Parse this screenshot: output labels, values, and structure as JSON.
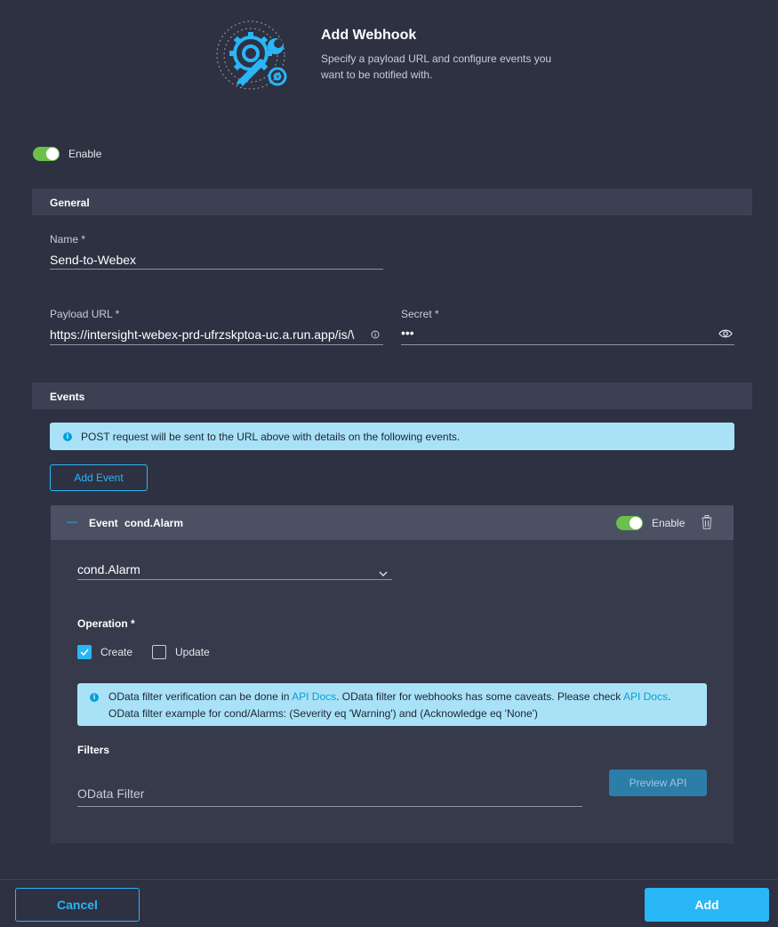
{
  "header": {
    "title": "Add Webhook",
    "subtitle": "Specify a payload URL and configure events you want to be notified with."
  },
  "enable": {
    "label": "Enable",
    "on": true
  },
  "general": {
    "section_title": "General",
    "name_label": "Name *",
    "name_value": "Send-to-Webex",
    "payload_label": "Payload URL *",
    "payload_value": "https://intersight-webex-prd-ufrzskptoa-uc.a.run.app/is/\\",
    "secret_label": "Secret *",
    "secret_value": "•••"
  },
  "events": {
    "section_title": "Events",
    "info_text": "POST request will be sent to the URL above with details on the following events.",
    "add_event_label": "Add Event",
    "event": {
      "collapse_symbol": "—",
      "label": "Event",
      "name": "cond.Alarm",
      "enable_label": "Enable",
      "enabled": true,
      "select_value": "cond.Alarm",
      "operation_label": "Operation *",
      "create_label": "Create",
      "create_checked": true,
      "update_label": "Update",
      "update_checked": false,
      "odata_info": {
        "part1": "OData filter verification can be done in ",
        "link1": "API Docs",
        "part2": ". OData filter for webhooks has some caveats. Please check ",
        "link2": "API Docs",
        "part3": ".",
        "line2": "OData filter example for cond/Alarms: (Severity eq 'Warning') and (Acknowledge eq 'None')"
      },
      "filters_label": "Filters",
      "filter_placeholder": "OData Filter",
      "preview_label": "Preview API"
    }
  },
  "footer": {
    "cancel_label": "Cancel",
    "add_label": "Add"
  },
  "colors": {
    "background": "#2d3142",
    "accent": "#29b6f6",
    "toggle_on": "#6cc04a",
    "info_banner": "#a9e2f7"
  }
}
